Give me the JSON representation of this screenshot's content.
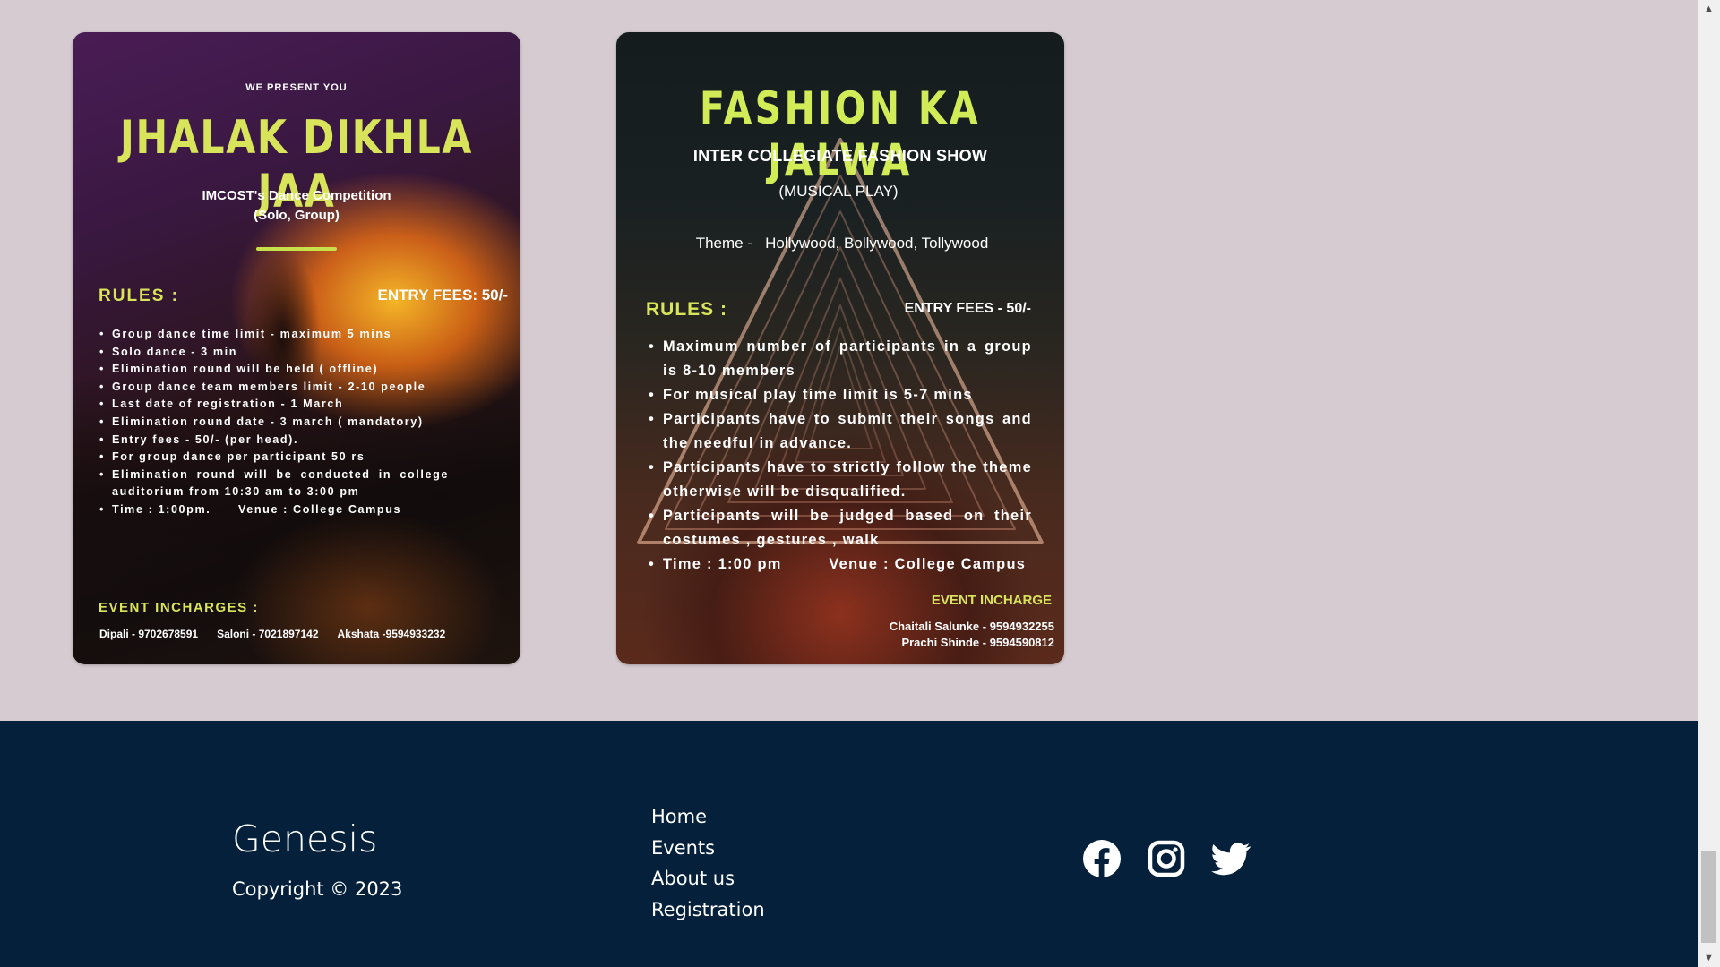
{
  "posters": {
    "dance": {
      "pre_title": "WE PRESENT YOU",
      "title": "JHALAK DIKHLA JAA",
      "subtitle_line1": "IMCOST's Dance Competition",
      "subtitle_line2": "(Solo, Group)",
      "rules_heading": "RULES :",
      "entry_fees": "ENTRY FEES: 50/-",
      "rules": [
        "Group dance time limit - maximum 5 mins",
        "Solo dance - 3 min",
        "Elimination round will be held ( offline)",
        "Group dance team members limit - 2-10 people",
        "Last date of registration - 1 March",
        "Elimination round date - 3 march ( mandatory)",
        "Entry fees - 50/- (per head).",
        " For group dance per participant 50 rs",
        "Elimination round will be conducted in college auditorium from 10:30 am to 3:00 pm",
        "Time : 1:00pm.      Venue : College Campus"
      ],
      "incharges_heading": "EVENT INCHARGES :",
      "incharges": [
        "Dipali - 9702678591",
        "Saloni - 7021897142",
        "Akshata -9594933232"
      ]
    },
    "fashion": {
      "title": "FASHION KA JALWA",
      "subtitle": "INTER COLLEGIATE FASHION SHOW",
      "subtitle2": "(MUSICAL PLAY)",
      "theme": "Theme -   Hollywood, Bollywood, Tollywood",
      "rules_heading": "RULES :",
      "entry_fees": "ENTRY FEES - 50/-",
      "rules": [
        "Maximum number of participants in a group is 8-10 members",
        "For musical play time limit is 5-7 mins",
        "Participants have to submit their songs and the needful in advance.",
        "Participants have to strictly follow the theme otherwise will be disqualified.",
        "Participants will be judged based on their costumes , gestures , walk",
        "Time : 1:00 pm         Venue : College Campus"
      ],
      "incharge_heading": "EVENT INCHARGE",
      "incharges": [
        "Chaitali Salunke - 9594932255",
        "Prachi Shinde - 9594590812"
      ]
    }
  },
  "footer": {
    "brand": "Genesis",
    "copyright": "Copyright © 2023",
    "links": [
      "Home",
      "Events",
      "About us",
      "Registration"
    ],
    "social_icons": [
      "facebook-icon",
      "instagram-icon",
      "twitter-icon"
    ]
  },
  "colors": {
    "page_background": "#d6cbd0",
    "footer_background": "#04203a",
    "poster_accent": "#d8e45a"
  }
}
